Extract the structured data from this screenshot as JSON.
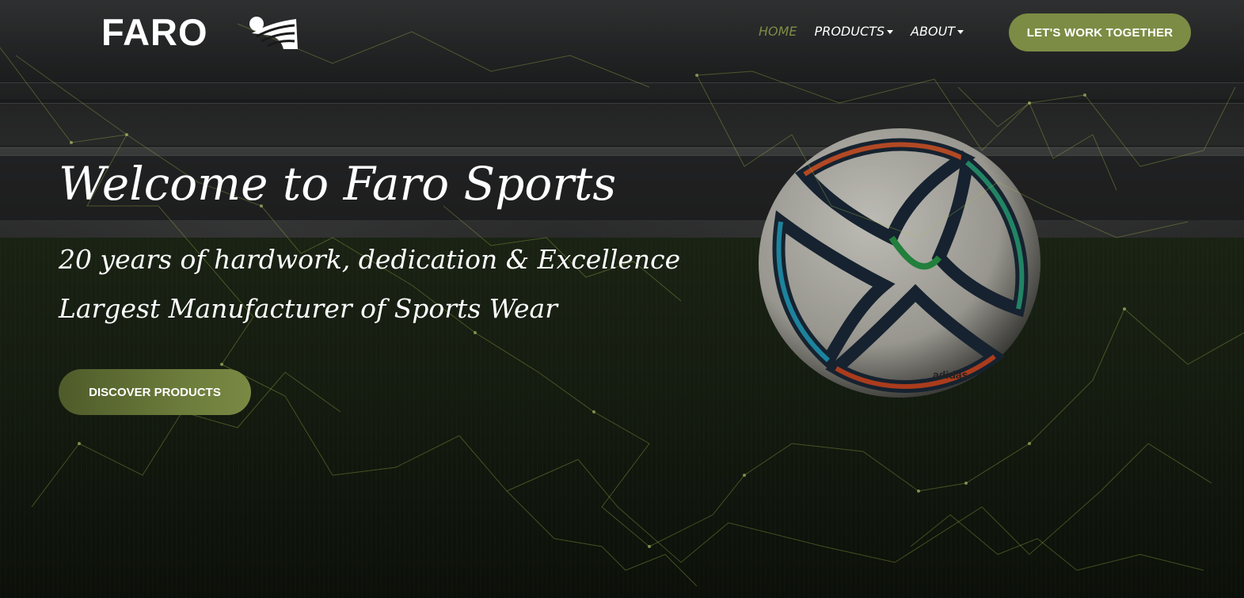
{
  "brand": {
    "logo_text": "FARO",
    "accent_color": "#7c8c44"
  },
  "nav": {
    "items": [
      {
        "label": "HOME",
        "active": true,
        "has_dropdown": false
      },
      {
        "label": "PRODUCTS",
        "active": false,
        "has_dropdown": true
      },
      {
        "label": "ABOUT",
        "active": false,
        "has_dropdown": true
      }
    ],
    "cta_label": "LET'S WORK TOGETHER"
  },
  "hero": {
    "headline": "Welcome to Faro Sports",
    "subline_1": "20 years of hardwork, dedication & Excellence",
    "subline_2": "Largest Manufacturer of Sports Wear",
    "button_label": "DISCOVER PRODUCTS",
    "background": "stadium-pitch-with-football",
    "ball_brand_text": "adidas"
  }
}
